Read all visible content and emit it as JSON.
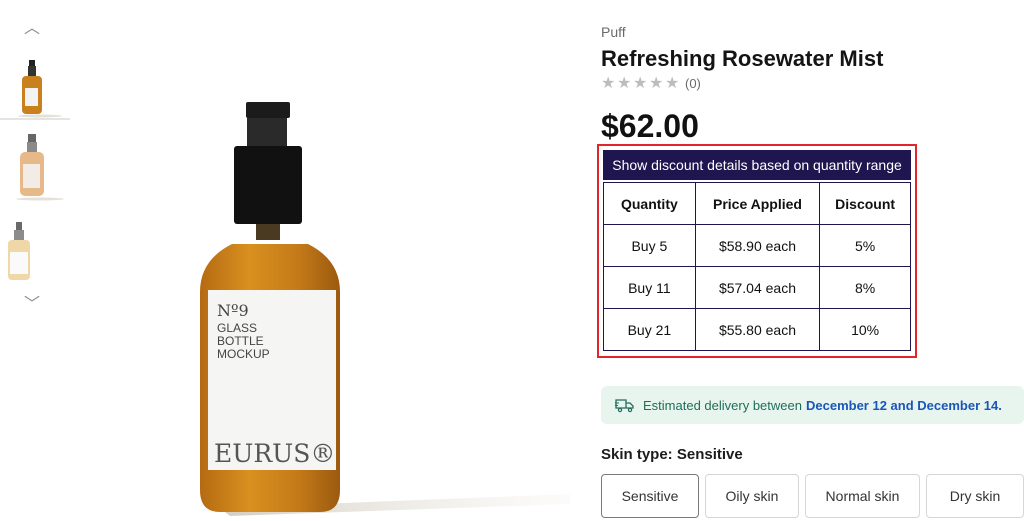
{
  "gallery": {
    "prev_arrow": "︿",
    "next_arrow": "﹀",
    "bottle_label": {
      "number": "Nº9",
      "line1": "GLASS",
      "line2": "BOTTLE",
      "line3": "MOCKUP",
      "brand": "EURUS®"
    }
  },
  "product": {
    "brand": "Puff",
    "title": "Refreshing Rosewater Mist",
    "rating_stars": 0,
    "rating_count": "(0)",
    "price": "$62.00"
  },
  "discount": {
    "header": "Show discount details based on quantity range",
    "columns": [
      "Quantity",
      "Price Applied",
      "Discount"
    ],
    "rows": [
      [
        "Buy 5",
        "$58.90 each",
        "5%"
      ],
      [
        "Buy 11",
        "$57.04 each",
        "8%"
      ],
      [
        "Buy 21",
        "$55.80 each",
        "10%"
      ]
    ]
  },
  "delivery": {
    "text": "Estimated delivery between",
    "dates": "December 12 and December 14."
  },
  "skin_type": {
    "label": "Skin type:",
    "selected": "Sensitive",
    "options": [
      "Sensitive",
      "Oily skin",
      "Normal skin",
      "Dry skin"
    ]
  },
  "colors": {
    "accent_header": "#1f1650",
    "highlight_border": "#e0262a",
    "delivery_bg": "#e8f5ee",
    "delivery_dates": "#1a56b8"
  }
}
